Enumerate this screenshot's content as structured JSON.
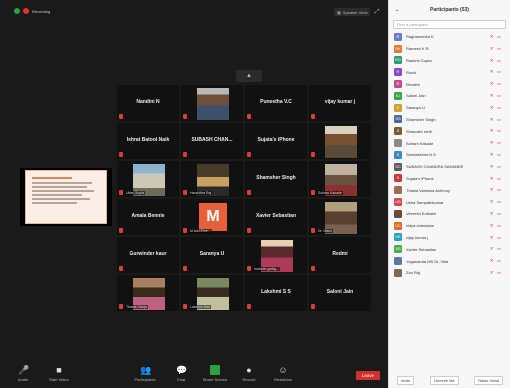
{
  "topbar": {
    "recording_label": "Recording",
    "speaker_view_label": "Speaker View"
  },
  "grid": {
    "tiles": [
      {
        "name": "Nandini N",
        "kind": "text"
      },
      {
        "name": "",
        "kind": "photo",
        "photo": "p-man1"
      },
      {
        "name": "Puneetha V.C",
        "kind": "text"
      },
      {
        "name": "vijay kumar j",
        "kind": "text"
      },
      {
        "name": "Ishrat Batool Naik",
        "kind": "text"
      },
      {
        "name": "SUBASH CHAN...",
        "kind": "text"
      },
      {
        "name": "Sujata's iPhone",
        "kind": "text"
      },
      {
        "name": "",
        "kind": "photo",
        "photo": "p-man2"
      },
      {
        "name": "",
        "kind": "photo",
        "photo": "p-church",
        "tag": "Uttar Gupta"
      },
      {
        "name": "",
        "kind": "photo",
        "photo": "p-crowd",
        "tag": "Harshitha Raj"
      },
      {
        "name": "Shamsher Singh",
        "kind": "text"
      },
      {
        "name": "",
        "kind": "photo",
        "photo": "p-group",
        "tag": "Soham Kakade"
      },
      {
        "name": "Amala Bennie",
        "kind": "text"
      },
      {
        "name": "",
        "kind": "m",
        "letter": "M",
        "tag": "M.Adv.Eme..."
      },
      {
        "name": "Xavier Sebastian",
        "kind": "text"
      },
      {
        "name": "",
        "kind": "photo",
        "photo": "p-family",
        "tag": "Dr. Manu"
      },
      {
        "name": "Gurwinder kaur",
        "kind": "text"
      },
      {
        "name": "Saranya U",
        "kind": "text"
      },
      {
        "name": "",
        "kind": "photo",
        "photo": "p-woman",
        "tag": "mahesh gadig..."
      },
      {
        "name": "Redmi",
        "kind": "text"
      },
      {
        "name": "",
        "kind": "photo",
        "photo": "p-woman2",
        "tag": "Thasla Ganja"
      },
      {
        "name": "",
        "kind": "photo",
        "photo": "p-woman3",
        "tag": "Lakshmi Ban"
      },
      {
        "name": "Lakshmi S S",
        "kind": "text"
      },
      {
        "name": "Saloni Jain",
        "kind": "text"
      }
    ]
  },
  "toolbar": {
    "audio": "Audio",
    "video": "Start Video",
    "participants": "Participants",
    "participants_count": "53",
    "chat": "Chat",
    "share": "Share Screen",
    "record": "Record",
    "reactions": "Reactions",
    "leave": "Leave"
  },
  "panel": {
    "title": "Participants (53)",
    "search_placeholder": "Find a participant",
    "participants": [
      {
        "name": "Raghavendra K",
        "initial": "R",
        "color": "#6a7bd0"
      },
      {
        "name": "Ramesh K R",
        "initial": "RK",
        "color": "#e07a2a"
      },
      {
        "name": "Rashmi Gupta",
        "initial": "RG",
        "color": "#2a9a7a"
      },
      {
        "name": "Ruchi",
        "initial": "R",
        "color": "#8a4ac8"
      },
      {
        "name": "Revathi",
        "initial": "R",
        "color": "#c84a8a"
      },
      {
        "name": "Saloni Jain",
        "initial": "SJ",
        "color": "#3aa04a"
      },
      {
        "name": "Saranya U",
        "initial": "S",
        "color": "#d0a02a"
      },
      {
        "name": "Shamsher Singh",
        "initial": "SS",
        "color": "#4a6a9a"
      },
      {
        "name": "Shasvath rohit",
        "initial": "S",
        "color": "#7a5a3a"
      },
      {
        "name": "Soham Kakade",
        "initial": "",
        "color": "#8a8a8a"
      },
      {
        "name": "Sreelakshmi.N.S",
        "initial": "S",
        "color": "#3a8ac8"
      },
      {
        "name": "SUBASH CHANDRA SAHANEE",
        "initial": "SC",
        "color": "#5a5a5a"
      },
      {
        "name": "Sujata's iPhone",
        "initial": "S",
        "color": "#c83a3a"
      },
      {
        "name": "Thasla Vanessa Anthony",
        "initial": "",
        "color": "#a06a5a"
      },
      {
        "name": "Usha Sampathkumar",
        "initial": "US",
        "color": "#d04a4a"
      },
      {
        "name": "Veeresh Kulkarni",
        "initial": "",
        "color": "#6a4a3a"
      },
      {
        "name": "vidya chandane",
        "initial": "VC",
        "color": "#e06a2a"
      },
      {
        "name": "vijay kumar j",
        "initial": "VK",
        "color": "#2aa0c0"
      },
      {
        "name": "Xavier Sebastian",
        "initial": "XS",
        "color": "#4ab04a"
      },
      {
        "name": "Yogananda MS Dr. Vital",
        "initial": "",
        "color": "#5a7a9a"
      },
      {
        "name": "Zoo Raj",
        "initial": "",
        "color": "#7a6a5a"
      }
    ],
    "footer": {
      "invite": "Invite",
      "mute_all": "Unmute Me",
      "raise_hand": "Raise Hand"
    }
  }
}
